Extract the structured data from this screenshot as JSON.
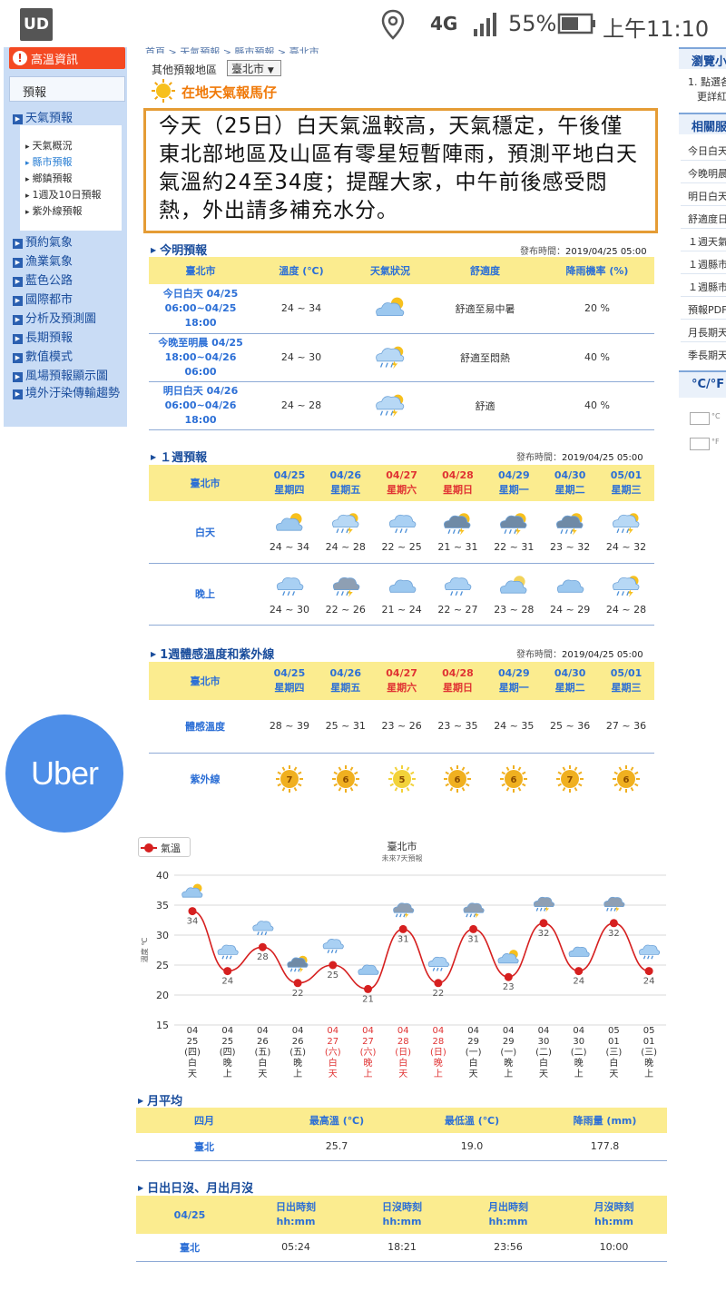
{
  "status_bar": {
    "app_icon_label": "UD",
    "network": "4G",
    "battery": "55%",
    "time": "上午11:10"
  },
  "sidebar": {
    "alert_label": "高溫資訊",
    "forecast_header": "預報",
    "weather_forecast": "天氣預報",
    "sub_items": [
      "天氣概況",
      "縣市預報",
      "鄉鎮預報",
      "1週及10日預報",
      "紫外線預報"
    ],
    "links": [
      "預約氣象",
      "漁業氣象",
      "藍色公路",
      "國際都市",
      "分析及預測圖",
      "長期預報",
      "數值模式",
      "風場預報顯示圖",
      "境外汙染傳輸趨勢"
    ]
  },
  "right_panel": {
    "browse_title": "瀏覽小",
    "browse_items": [
      "1. 點選各",
      "更詳紅"
    ],
    "related_title": "相關服",
    "related_items": [
      "今日白天",
      "今晚明晨",
      "明日白天",
      "舒適度日",
      "１週天氣",
      "１週縣市",
      "１週縣市",
      "預報PDF",
      "月長期天",
      "季長期天"
    ],
    "unit_title": "°C/°F",
    "unit_c": "°C",
    "unit_f": "°F"
  },
  "ad": {
    "label": "Uber"
  },
  "breadcrumb": "首頁 > 天氣預報 > 縣市預報 > 臺北市",
  "region": {
    "label": "其他預報地區",
    "selected": "臺北市"
  },
  "local_title": "在地天氣報馬仔",
  "summary": "今天（25日）白天氣溫較高，天氣穩定，午後僅東北部地區及山區有零星短暫陣雨，預測平地白天氣溫約24至34度；提醒大家，中午前後感受悶熱，外出請多補充水分。",
  "today_forecast": {
    "title": "今明預報",
    "pub_label": "發布時間：",
    "pub_time": "2019/04/25 05:00",
    "headers": [
      "臺北市",
      "溫度 (℃)",
      "天氣狀況",
      "舒適度",
      "降雨機率 (%)"
    ],
    "rows": [
      {
        "period": "今日白天 04/25",
        "range": "06:00~04/25 18:00",
        "temp": "24 ~ 34",
        "icon": "cloudy-sun-icon",
        "comfort": "舒適至易中暑",
        "rain": "20 %"
      },
      {
        "period": "今晚至明晨 04/25",
        "range": "18:00~04/26 06:00",
        "temp": "24 ~ 30",
        "icon": "thunder-rain-icon",
        "comfort": "舒適至悶熱",
        "rain": "40 %"
      },
      {
        "period": "明日白天 04/26",
        "range": "06:00~04/26 18:00",
        "temp": "24 ~ 28",
        "icon": "thunder-rain-icon",
        "comfort": "舒適",
        "rain": "40 %"
      }
    ]
  },
  "week_forecast": {
    "title": "１週預報",
    "pub_label": "發布時間：",
    "pub_time": "2019/04/25 05:00",
    "city": "臺北市",
    "days": [
      {
        "date": "04/25",
        "dow": "星期四",
        "weekend": false
      },
      {
        "date": "04/26",
        "dow": "星期五",
        "weekend": false
      },
      {
        "date": "04/27",
        "dow": "星期六",
        "weekend": true
      },
      {
        "date": "04/28",
        "dow": "星期日",
        "weekend": true
      },
      {
        "date": "04/29",
        "dow": "星期一",
        "weekend": false
      },
      {
        "date": "04/30",
        "dow": "星期二",
        "weekend": false
      },
      {
        "date": "05/01",
        "dow": "星期三",
        "weekend": false
      }
    ],
    "day_label": "白天",
    "night_label": "晚上",
    "day_temps": [
      "24 ~ 34",
      "24 ~ 28",
      "22 ~ 25",
      "21 ~ 31",
      "22 ~ 31",
      "23 ~ 32",
      "24 ~ 32"
    ],
    "night_temps": [
      "24 ~ 30",
      "22 ~ 26",
      "21 ~ 24",
      "22 ~ 27",
      "23 ~ 28",
      "24 ~ 29",
      "24 ~ 28"
    ],
    "day_icons": [
      "cloudy-sun-icon",
      "thunder-rain-icon",
      "cloud-rain-icon",
      "sun-thunder-icon",
      "sun-thunder-icon",
      "sun-thunder-icon",
      "thunder-rain-icon"
    ],
    "night_icons": [
      "cloud-rain-icon",
      "thunderstorm-icon",
      "cloud-icon",
      "cloud-rain-icon",
      "cloudy-moon-icon",
      "cloud-icon",
      "thunder-rain-icon"
    ]
  },
  "feel_uv": {
    "title": "1週體感溫度和紫外線",
    "pub_label": "發布時間：",
    "pub_time": "2019/04/25 05:00",
    "city": "臺北市",
    "feel_label": "體感溫度",
    "feels": [
      "28 ~ 39",
      "25 ~ 31",
      "23 ~ 26",
      "23 ~ 35",
      "24 ~ 35",
      "25 ~ 36",
      "27 ~ 36"
    ],
    "uv_label": "紫外線",
    "uv": [
      "7",
      "6",
      "5",
      "6",
      "6",
      "7",
      "6"
    ],
    "uv_colors": [
      "#f0b020",
      "#f0b020",
      "#f2d23a",
      "#f0b020",
      "#f0b020",
      "#f0b020",
      "#f0b020"
    ]
  },
  "chart_data": {
    "type": "line",
    "title": "臺北市",
    "subtitle": "未來7天預報",
    "ylabel": "溫度 ℃",
    "ylim": [
      15,
      40
    ],
    "yticks": [
      "15",
      "20",
      "25",
      "30",
      "35",
      "40"
    ],
    "series": [
      {
        "name": "氣溫",
        "color": "#d62020",
        "values": [
          34,
          24,
          28,
          22,
          25,
          21,
          31,
          22,
          31,
          23,
          32,
          24,
          32,
          24
        ]
      }
    ],
    "categories": [
      {
        "d": "04",
        "m": "25",
        "w": "(四)",
        "p": "白天",
        "red": false
      },
      {
        "d": "04",
        "m": "25",
        "w": "(四)",
        "p": "晚上",
        "red": false
      },
      {
        "d": "04",
        "m": "26",
        "w": "(五)",
        "p": "白天",
        "red": false
      },
      {
        "d": "04",
        "m": "26",
        "w": "(五)",
        "p": "晚上",
        "red": false
      },
      {
        "d": "04",
        "m": "27",
        "w": "(六)",
        "p": "白天",
        "red": true
      },
      {
        "d": "04",
        "m": "27",
        "w": "(六)",
        "p": "晚上",
        "red": true
      },
      {
        "d": "04",
        "m": "28",
        "w": "(日)",
        "p": "白天",
        "red": true
      },
      {
        "d": "04",
        "m": "28",
        "w": "(日)",
        "p": "晚上",
        "red": true
      },
      {
        "d": "04",
        "m": "29",
        "w": "(一)",
        "p": "白天",
        "red": false
      },
      {
        "d": "04",
        "m": "29",
        "w": "(一)",
        "p": "晚上",
        "red": false
      },
      {
        "d": "04",
        "m": "30",
        "w": "(二)",
        "p": "白天",
        "red": false
      },
      {
        "d": "04",
        "m": "30",
        "w": "(二)",
        "p": "晚上",
        "red": false
      },
      {
        "d": "05",
        "m": "01",
        "w": "(三)",
        "p": "白天",
        "red": false
      },
      {
        "d": "05",
        "m": "01",
        "w": "(三)",
        "p": "晚上",
        "red": false
      }
    ],
    "icons": [
      "cloudy-sun-icon",
      "cloud-rain-icon",
      "cloud-rain-icon",
      "sun-thunder-icon",
      "cloud-rain-icon",
      "cloud-icon",
      "thunderstorm-icon",
      "cloud-rain-icon",
      "thunderstorm-icon",
      "cloudy-sun-icon",
      "thunderstorm-icon",
      "cloud-icon",
      "thunderstorm-icon",
      "cloud-rain-icon"
    ],
    "grid": true,
    "legend": "top-left"
  },
  "monthly": {
    "title": "月平均",
    "headers": [
      "四月",
      "最高溫 (℃)",
      "最低溫 (℃)",
      "降雨量 (mm)"
    ],
    "row": [
      "臺北",
      "25.7",
      "19.0",
      "177.8"
    ]
  },
  "sunmoon": {
    "title": "日出日沒、月出月沒",
    "date": "04/25",
    "headers": [
      "日出時刻",
      "日沒時刻",
      "月出時刻",
      "月沒時刻"
    ],
    "unit": "hh:mm",
    "row": [
      "臺北",
      "05:24",
      "18:21",
      "23:56",
      "10:00"
    ]
  }
}
